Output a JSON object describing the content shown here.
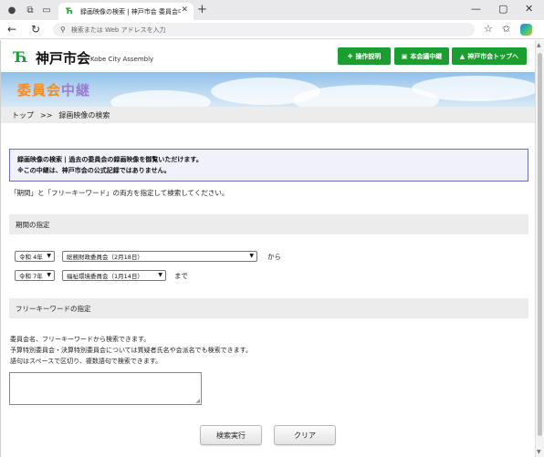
{
  "browser": {
    "tab_title": "録画映像の検索 | 神戸市会 委員会中継",
    "url_placeholder": "検索または Web アドレスを入力"
  },
  "header": {
    "logo_mark": "Ћ",
    "logo_text": "神戸市会",
    "logo_en": "Kobe City Assembly",
    "buttons": [
      {
        "icon": "✚",
        "label": "操作説明"
      },
      {
        "icon": "▣",
        "label": "本会議中継"
      },
      {
        "icon": "▲",
        "label": "神戸市会トップへ"
      }
    ]
  },
  "banner": {
    "title_parts": [
      {
        "text": "委員会",
        "color": "#f28c28"
      },
      {
        "text": "中継",
        "color": "#9a7fd1"
      }
    ]
  },
  "breadcrumb": {
    "home": "トップ",
    "separator": ">>",
    "current": "録画映像の検索"
  },
  "notice": {
    "line1": "録画映像の検索 | 過去の委員会の録画映像を御覧いただけます。",
    "line2": "※この中継は、神戸市会の公式記録ではありません。"
  },
  "instruction": "「期間」と「フリーキーワード」の両方を指定して検索してください。",
  "period": {
    "heading": "期間の指定",
    "from": {
      "year": "令和 4年",
      "meeting": "総務財政委員会（2月18日）",
      "suffix": "から"
    },
    "to": {
      "year": "令和 7年",
      "meeting": "福祉環境委員会（1月14日）",
      "suffix": "まで"
    }
  },
  "keyword": {
    "heading": "フリーキーワードの指定",
    "desc1": "委員会名、フリーキーワードから検索できます。",
    "desc2": "予算特別委員会・決算特別委員会については質疑者氏名や会派名でも検索できます。",
    "desc3": "語句はスペースで区切り、複数語句で検索できます。",
    "value": ""
  },
  "actions": {
    "search": "検索実行",
    "clear": "クリア"
  },
  "colors": {
    "brand_green": "#1a9e2e",
    "notice_border": "#6a6fb0"
  }
}
